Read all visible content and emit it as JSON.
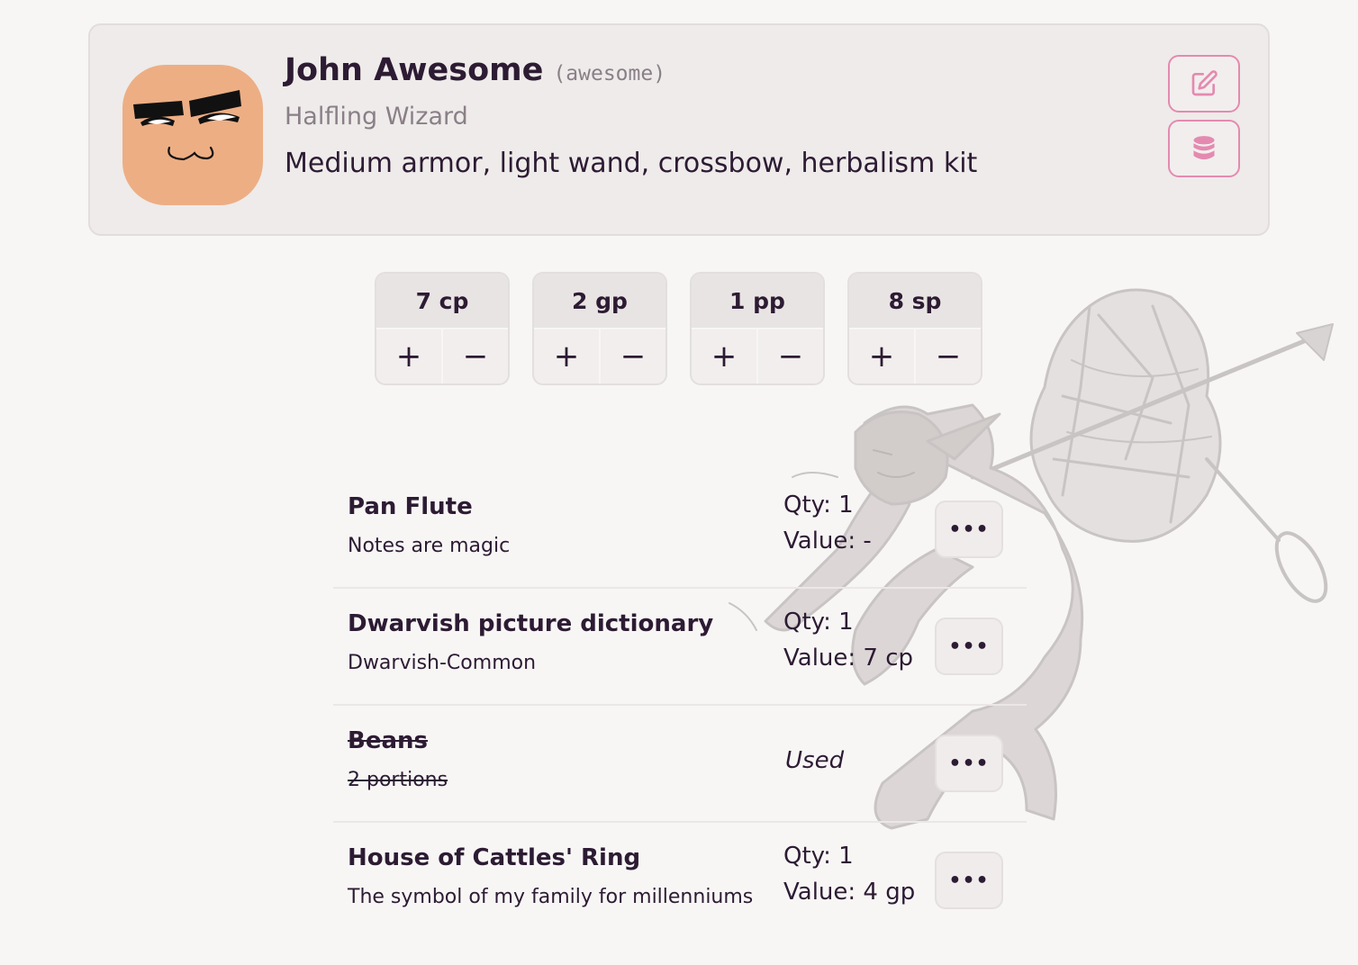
{
  "character": {
    "name": "John Awesome",
    "handle": "(awesome)",
    "class": "Halfling Wizard",
    "equipment": "Medium armor, light wand, crossbow, herbalism kit"
  },
  "actions": {
    "edit_icon": "edit-icon",
    "data_icon": "database-icon",
    "accent_color": "#e48ab0"
  },
  "money": [
    {
      "amount": "7 cp",
      "plus": "+",
      "minus": "−"
    },
    {
      "amount": "2 gp",
      "plus": "+",
      "minus": "−"
    },
    {
      "amount": "1 pp",
      "plus": "+",
      "minus": "−"
    },
    {
      "amount": "8 sp",
      "plus": "+",
      "minus": "−"
    }
  ],
  "items": [
    {
      "name": "Pan Flute",
      "note": "Notes are magic",
      "qty": "Qty: 1",
      "value": "Value: -",
      "menu": "•••"
    },
    {
      "name": "Dwarvish picture dictionary",
      "note": "Dwarvish-Common",
      "qty": "Qty: 1",
      "value": "Value: 7 cp",
      "menu": "•••"
    },
    {
      "name": "Beans",
      "note": "2 portions",
      "status": "Used",
      "menu": "•••"
    },
    {
      "name": "House of Cattles' Ring",
      "note": "The symbol of my family for millenniums",
      "qty": "Qty: 1",
      "value": "Value: 4 gp",
      "menu": "•••"
    }
  ]
}
